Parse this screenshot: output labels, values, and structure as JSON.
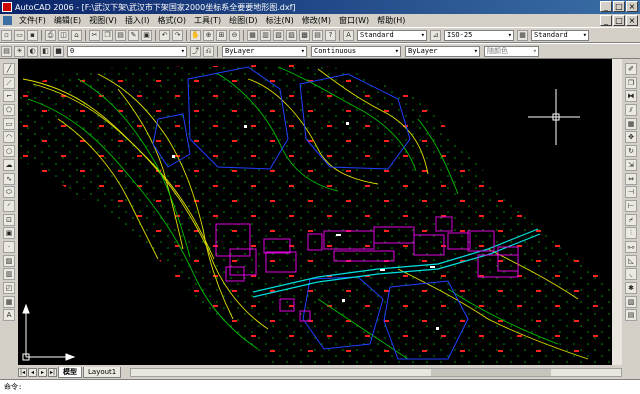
{
  "window": {
    "title": "AutoCAD 2006 - [F:\\武汉下架\\武汉市下架国家2000坐标系全要要地形图.dxf]",
    "controls": [
      "_",
      "□",
      "×"
    ]
  },
  "menu": {
    "items": [
      "文件(F)",
      "编辑(E)",
      "视图(V)",
      "插入(I)",
      "格式(O)",
      "工具(T)",
      "绘图(D)",
      "标注(N)",
      "修改(M)",
      "窗口(W)",
      "帮助(H)"
    ]
  },
  "styles": {
    "text_style": "Standard",
    "dim_style": "ISO-25",
    "table_style": "Standard"
  },
  "layers": {
    "current_layer": "0",
    "color": "ByLayer",
    "linetype": "Continuous",
    "lineweight": "ByLayer",
    "plotstyle": "随颜色"
  },
  "layout_tabs": [
    "模型",
    "Layout1"
  ],
  "command": {
    "prompt": "命令:"
  },
  "colors": {
    "canvas": "#000000",
    "contour_yellow": "#e0e000",
    "contour_green": "#00c000",
    "buildings": "#e000e0",
    "road": "#00e0e0",
    "field_boundary": "#2040ff",
    "points": "#ff2020"
  }
}
